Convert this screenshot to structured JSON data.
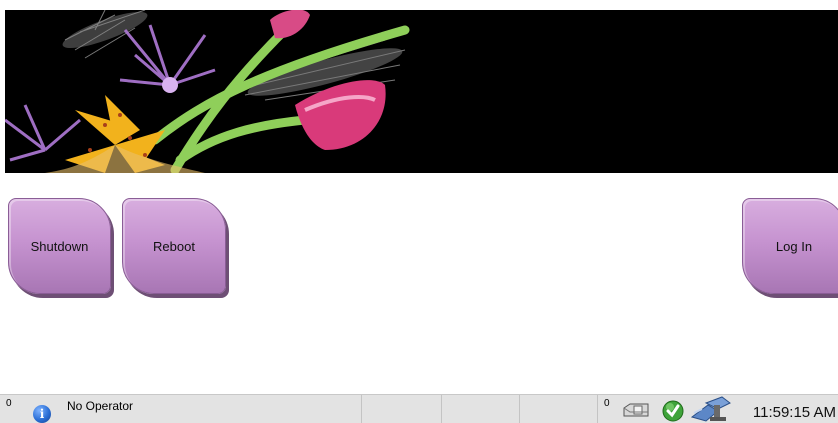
{
  "buttons": {
    "shutdown_label": "Shutdown",
    "reboot_label": "Reboot",
    "login_label": "Log In"
  },
  "statusbar": {
    "left_count": "0",
    "operator": "No Operator",
    "right_count": "0",
    "time": "11:59:15 AM"
  },
  "icons": {
    "info": "info-icon",
    "media": "media-tray-icon",
    "status_ok": "check-status-icon",
    "gantry": "gantry-icon"
  },
  "colors": {
    "button_fill": "#c693d0",
    "banner_bg": "#000000",
    "statusbar_bg": "#e3e3e3"
  }
}
